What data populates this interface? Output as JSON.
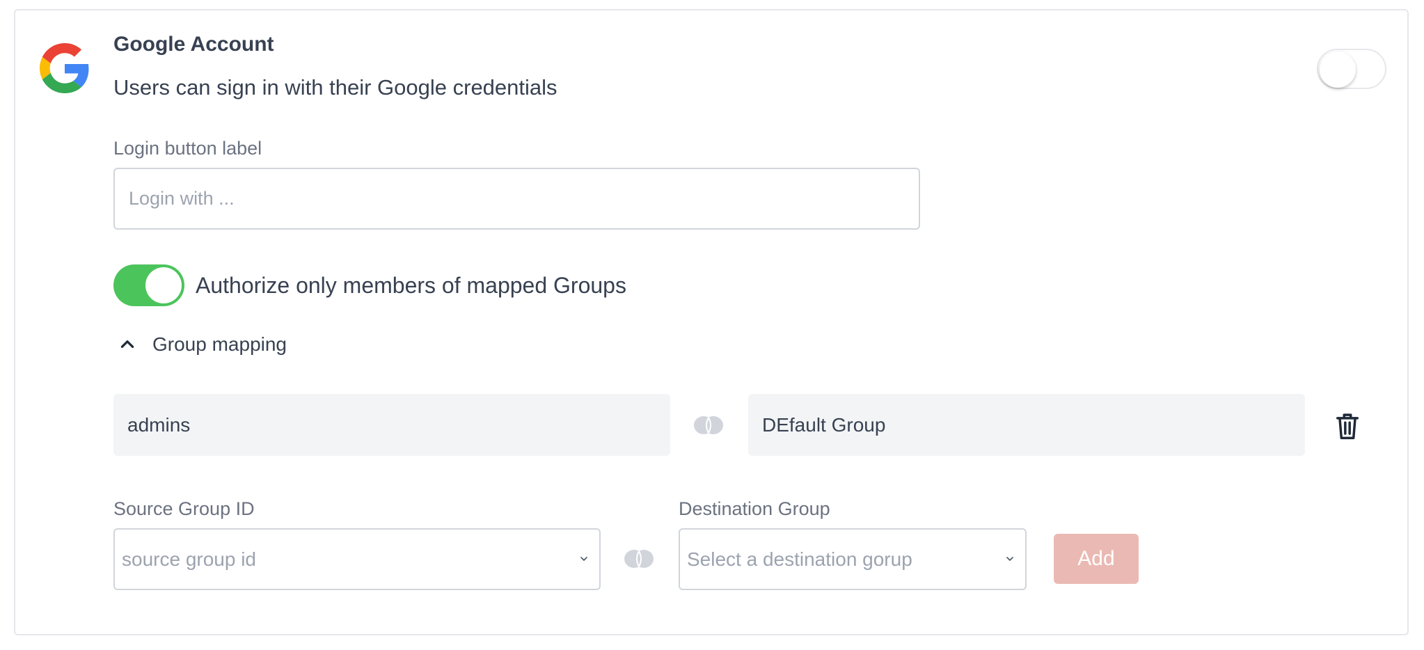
{
  "provider": {
    "title": "Google Account",
    "description": "Users can sign in with their Google credentials",
    "logo_icon": "google-g-icon",
    "enabled": false
  },
  "login_button": {
    "label": "Login button label",
    "placeholder": "Login with ...",
    "value": ""
  },
  "authorize_toggle": {
    "label": "Authorize only members of mapped Groups",
    "enabled": true,
    "on_color": "#4cc45c"
  },
  "group_mapping": {
    "label": "Group mapping",
    "expanded": true,
    "mappings": [
      {
        "source": "admins",
        "destination": "DEfault Group"
      }
    ],
    "new_mapping": {
      "source_label": "Source Group ID",
      "source_placeholder": "source group id",
      "destination_label": "Destination Group",
      "destination_placeholder": "Select a destination gorup",
      "add_label": "Add",
      "add_color": "#ebb9b3"
    }
  }
}
